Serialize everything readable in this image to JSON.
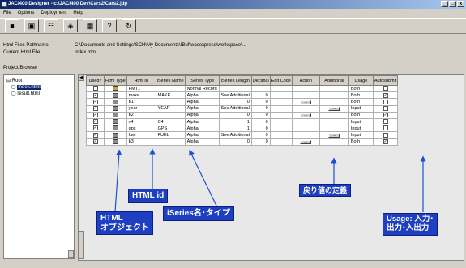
{
  "window": {
    "title": "JACi400 Designer - c:\\JACi400 Dev\\Cars2\\Cars2.jdp",
    "controls": [
      "_",
      "□",
      "x"
    ]
  },
  "menu": [
    "File",
    "Options",
    "Deployment",
    "Help"
  ],
  "toolbar": [
    "save-icon",
    "open-icon",
    "pages-icon",
    "connect-icon",
    "deploy-icon",
    "help-icon",
    "refresh-icon"
  ],
  "info": {
    "pathname_label": "Html Files Pathname",
    "pathname_value": "C:\\Documents and Settings\\SCH\\My Documents\\IBM\\wasexpress\\workspace\\...",
    "current_label": "Current Html File",
    "current_value": "index.html"
  },
  "project_browser": {
    "label": "Project Browser",
    "nodes": [
      "Root",
      "index.html",
      "result.html"
    ]
  },
  "grid": {
    "columns": [
      "Used?",
      "Html Type",
      "Html Id",
      "iSeries Name",
      "iSeries Type",
      "iSeries Length",
      "Decimal",
      "Edit Code",
      "Action",
      "Additional",
      "Usage",
      "Autosubmit"
    ],
    "rows": [
      {
        "used": false,
        "id": "FMT1",
        "name": "",
        "type": "Normal Record",
        "length": "",
        "decimal": "",
        "action": false,
        "additional": false,
        "usage": "Both",
        "auto": false
      },
      {
        "used": true,
        "id": "make",
        "name": "MAKE",
        "type": "Alpha",
        "length": "See Additional",
        "decimal": "0",
        "action": false,
        "additional": false,
        "usage": "Both",
        "auto": true
      },
      {
        "used": true,
        "id": "b1",
        "name": "",
        "type": "Alpha",
        "length": "0",
        "decimal": "0",
        "action": true,
        "additional": false,
        "usage": "Both",
        "auto": false
      },
      {
        "used": true,
        "id": "year",
        "name": "YEAR",
        "type": "Alpha",
        "length": "See Additional",
        "decimal": "0",
        "action": false,
        "additional": true,
        "usage": "Input",
        "auto": false
      },
      {
        "used": true,
        "id": "b2",
        "name": "",
        "type": "Alpha",
        "length": "0",
        "decimal": "0",
        "action": true,
        "additional": false,
        "usage": "Both",
        "auto": true
      },
      {
        "used": true,
        "id": "c4",
        "name": "C4",
        "type": "Alpha",
        "length": "1",
        "decimal": "0",
        "action": false,
        "additional": false,
        "usage": "Input",
        "auto": false
      },
      {
        "used": true,
        "id": "gps",
        "name": "GPS",
        "type": "Alpha",
        "length": "1",
        "decimal": "0",
        "action": false,
        "additional": false,
        "usage": "Input",
        "auto": false
      },
      {
        "used": true,
        "id": "fuel",
        "name": "FUEL",
        "type": "Alpha",
        "length": "See Additional",
        "decimal": "0",
        "action": false,
        "additional": true,
        "usage": "Input",
        "auto": false
      },
      {
        "used": true,
        "id": "b3",
        "name": "",
        "type": "Alpha",
        "length": "0",
        "decimal": "0",
        "action": true,
        "additional": false,
        "usage": "Both",
        "auto": true
      }
    ]
  },
  "callouts": {
    "html_id": "HTML id",
    "html_object": "HTML\nオブジェクト",
    "iseries": "iSeries名･タイプ",
    "return": "戻り値の定義",
    "usage": "Usage: 入力･\n出力･入出力"
  },
  "colors": {
    "callout_bg": "#1e3fbf",
    "arrow": "#1e4fd0",
    "titlebar": "#0a246a"
  }
}
